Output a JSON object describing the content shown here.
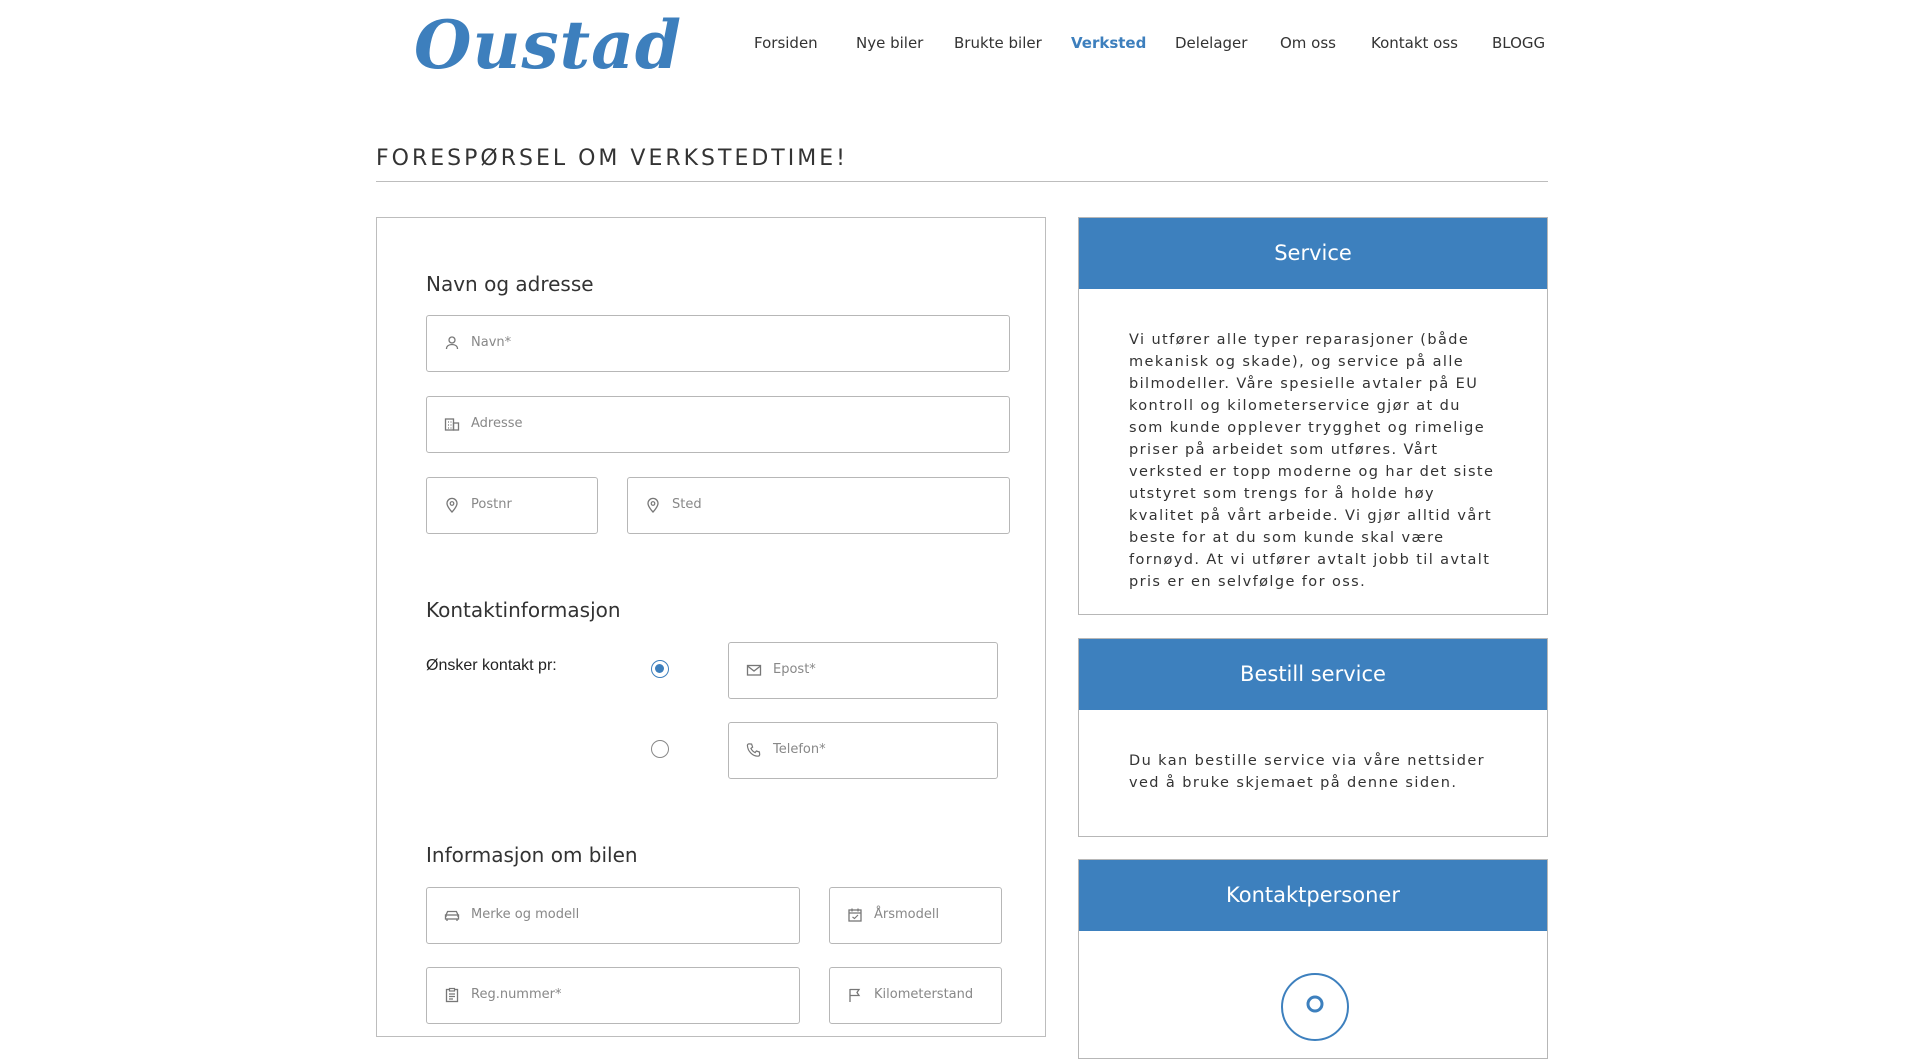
{
  "brand": {
    "logo_text": "Oustad",
    "accent": "#3d7fbd"
  },
  "nav": {
    "items": [
      {
        "label": "Forsiden"
      },
      {
        "label": "Nye biler"
      },
      {
        "label": "Brukte biler"
      },
      {
        "label": "Verksted",
        "active": true
      },
      {
        "label": "Delelager"
      },
      {
        "label": "Om oss"
      },
      {
        "label": "Kontakt oss"
      },
      {
        "label": "BLOGG"
      }
    ]
  },
  "page": {
    "title": "FORESPØRSEL OM VERKSTEDTIME!"
  },
  "form": {
    "section_address": "Navn og adresse",
    "section_contact": "Kontaktinformasjon",
    "section_car": "Informasjon om bilen",
    "name_placeholder": "Navn*",
    "address_placeholder": "Adresse",
    "zip_placeholder": "Postnr",
    "city_placeholder": "Sted",
    "contact_pref_label": "Ønsker kontakt pr:",
    "email_placeholder": "Epost*",
    "phone_placeholder": "Telefon*",
    "contact_pref_selected": "email",
    "make_placeholder": "Merke og modell",
    "year_placeholder": "Årsmodell",
    "reg_placeholder": "Reg.nummer*",
    "km_placeholder": "Kilometerstand"
  },
  "sidebar": {
    "service": {
      "title": "Service",
      "text": "Vi utfører alle typer reparasjoner (både mekanisk og skade), og service på alle bilmodeller. Våre spesielle avtaler på EU kontroll og kilometerservice gjør at du som kunde opplever trygghet og rimelige priser på arbeidet som utføres. Vårt verksted er topp moderne og har det siste utstyret som trengs for å holde høy kvalitet på vårt arbeide. Vi gjør alltid vårt beste for at du som kunde skal være fornøyd. At vi utfører avtalt jobb til avtalt pris er en selvfølge for oss."
    },
    "order": {
      "title": "Bestill service",
      "text": "Du kan bestille service via våre nettsider ved å bruke skjemaet på denne siden."
    },
    "contacts": {
      "title": "Kontaktpersoner"
    }
  }
}
